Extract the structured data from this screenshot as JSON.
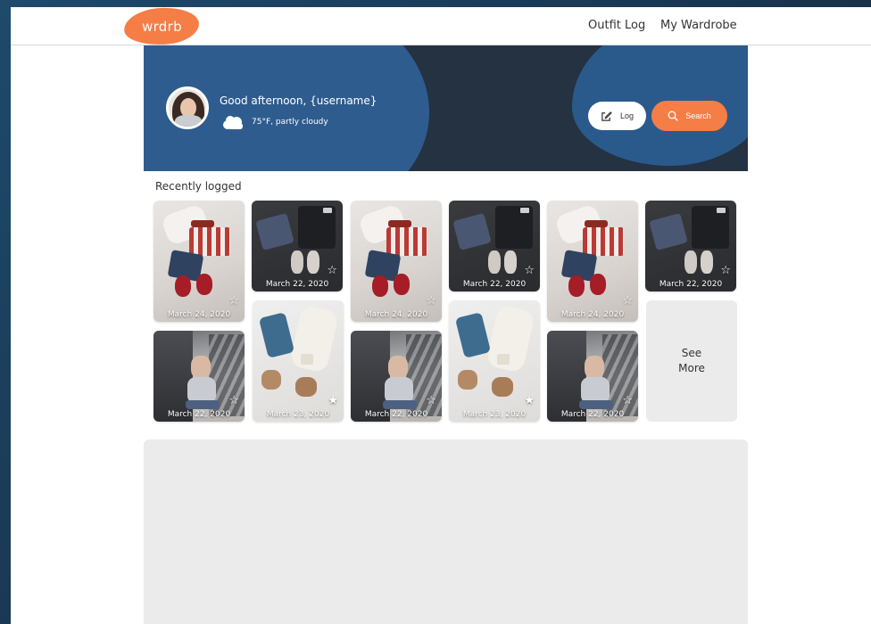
{
  "nav": {
    "logo": "wrdrb",
    "links": [
      "Outfit Log",
      "My Wardrobe"
    ]
  },
  "hero": {
    "greeting": "Good afternoon, {username}",
    "weather": "75°F, partly cloudy",
    "weather_icon": "cloud-icon",
    "log_button": "Log",
    "log_icon": "edit-icon",
    "search_button": "Search",
    "search_icon": "search-icon"
  },
  "recent": {
    "title": "Recently logged",
    "see_more": [
      "See",
      "More"
    ],
    "cards": [
      {
        "date": "March 24, 2020",
        "favorited": false,
        "theme": "white"
      },
      {
        "date": "March 22, 2020",
        "favorited": false,
        "theme": "dark"
      },
      {
        "date": "March 24, 2020",
        "favorited": false,
        "theme": "white"
      },
      {
        "date": "March 22, 2020",
        "favorited": false,
        "theme": "dark"
      },
      {
        "date": "March 24, 2020",
        "favorited": false,
        "theme": "white"
      },
      {
        "date": "March 22, 2020",
        "favorited": false,
        "theme": "dark"
      },
      {
        "date": "March 22, 2020",
        "favorited": false,
        "theme": "shoe"
      },
      {
        "date": "March 23, 2020",
        "favorited": true,
        "theme": "cream"
      },
      {
        "date": "March 22, 2020",
        "favorited": false,
        "theme": "shoe"
      },
      {
        "date": "March 23, 2020",
        "favorited": true,
        "theme": "cream"
      },
      {
        "date": "March 22, 2020",
        "favorited": false,
        "theme": "shoe"
      }
    ]
  },
  "colors": {
    "accent": "#f57d46",
    "hero_bg": "#243242",
    "hero_blob": "#2f5c8e"
  }
}
